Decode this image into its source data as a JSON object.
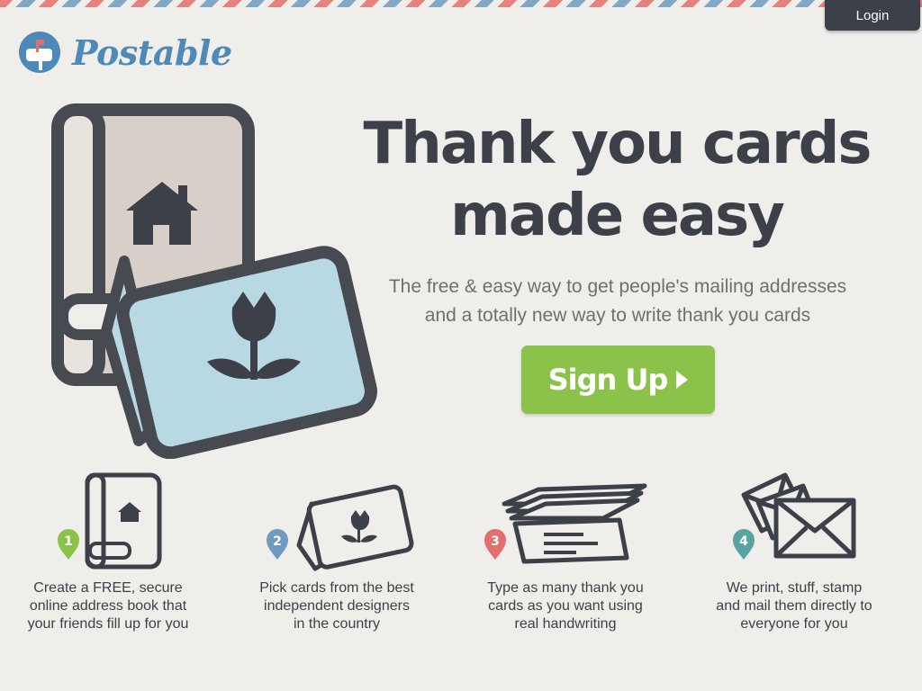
{
  "header": {
    "login_label": "Login",
    "logo_text": "Postable"
  },
  "hero": {
    "headline_line1": "Thank you cards",
    "headline_line2": "made easy",
    "subtitle_line1": "The free & easy way to get people's mailing addresses",
    "subtitle_line2": "and a totally new way to write thank you cards",
    "signup_label": "Sign Up"
  },
  "steps": [
    {
      "number": "1",
      "badge_color": "#8bc34a",
      "icon": "address-book-icon",
      "lines": [
        "Create a FREE, secure",
        "online address book that",
        "your friends fill up for you"
      ]
    },
    {
      "number": "2",
      "badge_color": "#6f9bc0",
      "icon": "card-icon",
      "lines": [
        "Pick cards from the best",
        "independent designers",
        "in the country"
      ]
    },
    {
      "number": "3",
      "badge_color": "#e46e6b",
      "icon": "cards-stack-icon",
      "lines": [
        "Type as many thank you",
        "cards as you want using",
        "real handwriting"
      ]
    },
    {
      "number": "4",
      "badge_color": "#5aa3a3",
      "icon": "envelopes-icon",
      "lines": [
        "We print, stuff, stamp",
        "and mail them directly to",
        "everyone for you"
      ]
    }
  ],
  "colors": {
    "accent_green": "#8bc34a",
    "brand_blue": "#4d8ab8",
    "dark": "#3c4048",
    "card_blue": "#b8d9e4",
    "book_beige": "#d8d0c8"
  }
}
